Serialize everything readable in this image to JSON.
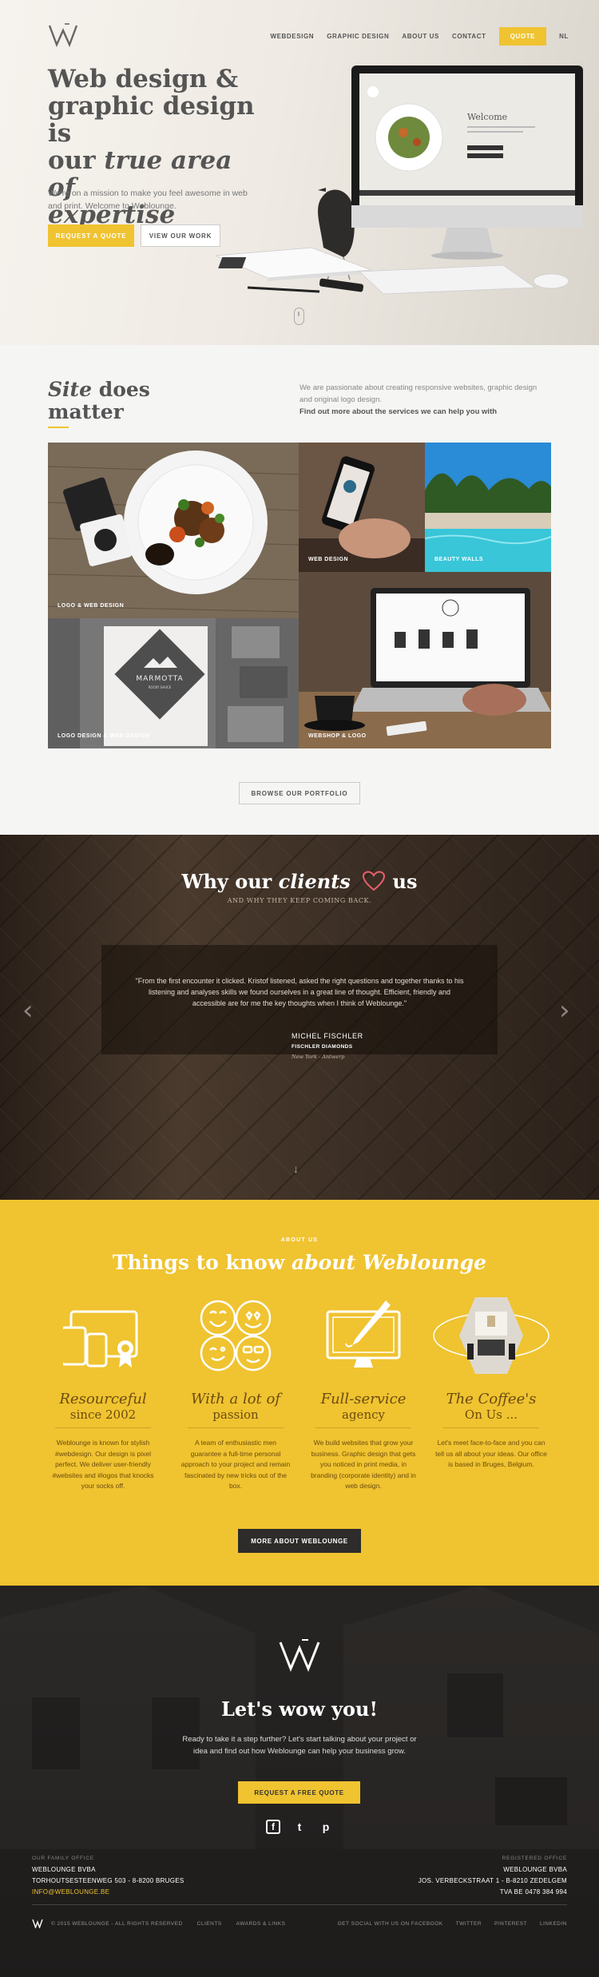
{
  "brand": {
    "logo_letter": "W",
    "accent": "#f0c330",
    "dark": "#2d2c2b"
  },
  "nav": {
    "items": [
      "WEBDESIGN",
      "GRAPHIC DESIGN",
      "ABOUT US",
      "CONTACT"
    ],
    "quote": "QUOTE",
    "lang": "NL"
  },
  "hero": {
    "title_line1": "Web design &",
    "title_line2": "graphic design is",
    "title_line3a": "our ",
    "title_line3b": "true area of",
    "title_line4": "expertise",
    "subtitle": "We're on a mission to make you feel awesome in web and print. Welcome to Weblounge.",
    "btn_primary": "REQUEST A QUOTE",
    "btn_secondary": "VIEW OUR WORK",
    "screen_heading": "Welcome"
  },
  "site": {
    "title_italic": "Site",
    "title_rest": " does",
    "title_line2": "matter",
    "text": "We are passionate about creating responsive websites, graphic design and original logo design.",
    "link": "Find out more about the services we can help you with",
    "tiles": [
      {
        "label": "LOGO & WEB DESIGN"
      },
      {
        "label": "WEB DESIGN"
      },
      {
        "label": "BEAUTY WALLS"
      },
      {
        "label": "LOGO DESIGN & WEB DESIGN"
      },
      {
        "label": "WEBSHOP & LOGO"
      }
    ],
    "marmotta_name": "MARMOTTA",
    "marmotta_sub": "ROCKY SAUCE",
    "portfolio_btn": "BROWSE OUR PORTFOLIO"
  },
  "why": {
    "title_a": "Why our ",
    "title_b": "clients",
    "title_c": " us",
    "heart_icon": "heart-icon",
    "subtitle": "AND WHY THEY KEEP COMING BACK.",
    "quote": "\"From the first encounter it clicked. Kristof listened, asked the right questions and together thanks to his listening and analyses skills we found ourselves in a great line of thought. Efficient, friendly and accessible are for me the key thoughts when I think of Weblounge.\"",
    "name": "MICHEL FISCHLER",
    "company": "FISCHLER DIAMONDS",
    "location": "New York - Antwerp",
    "prev": "‹",
    "next": "›",
    "down": "↓"
  },
  "about": {
    "eyebrow": "ABOUT US",
    "title_a": "Things to know ",
    "title_b": "about Weblounge",
    "features": [
      {
        "h1": "Resourceful",
        "h2": "since 2002",
        "text": "Weblounge is known for stylish #webdesign. Our design is pixel perfect. We deliver user-friendly #websites and #logos that knocks your socks off.",
        "icon": "devices-icon"
      },
      {
        "h1": "With a lot of",
        "h2": "passion",
        "text": "A team of enthusiastic men guarantee a full-time personal approach to your project and remain fascinated by new tricks out of the box.",
        "icon": "smileys-icon"
      },
      {
        "h1": "Full-service",
        "h2": "agency",
        "text": "We build websites that grow your business. Graphic design that gets you noticed in print media, in branding (corporate identity) and in web design.",
        "icon": "monitor-brush-icon"
      },
      {
        "h1": "The Coffee's",
        "h2": "On Us ...",
        "text": "Let's meet face-to-face and you can tell us all about your ideas. Our office is based in Bruges, Belgium.",
        "icon": "office-photo-icon"
      }
    ],
    "more_btn": "MORE ABOUT WEBLOUNGE"
  },
  "footer": {
    "title": "Let's wow you!",
    "text": "Ready to take it a step further? Let's start talking about your project or idea and find out how Weblounge can help your business grow.",
    "cta": "REQUEST A FREE QUOTE",
    "social": [
      "f",
      "t",
      "p"
    ],
    "left_office": {
      "label": "OUR FAMILY OFFICE",
      "company": "WEBLOUNGE BVBA",
      "address": "TORHOUTSESTEENWEG 503 - 8-8200 BRUGES",
      "email": "INFO@WEBLOUNGE.BE"
    },
    "right_office": {
      "label": "REGISTERED OFFICE",
      "company": "WEBLOUNGE BVBA",
      "address": "JOS. VERBECKSTRAAT 1 - B-8210 ZEDELGEM",
      "vat": "TVA BE 0478 384 994"
    },
    "copyright": "© 2015 WEBLOUNGE - ALL RIGHTS RESERVED",
    "links": [
      "CLIENTS",
      "AWARDS & LINKS"
    ],
    "social_text": "GET SOCIAL WITH US ON FACEBOOK",
    "social_links": [
      "TWITTER",
      "PINTEREST",
      "LINKEDIN"
    ]
  }
}
